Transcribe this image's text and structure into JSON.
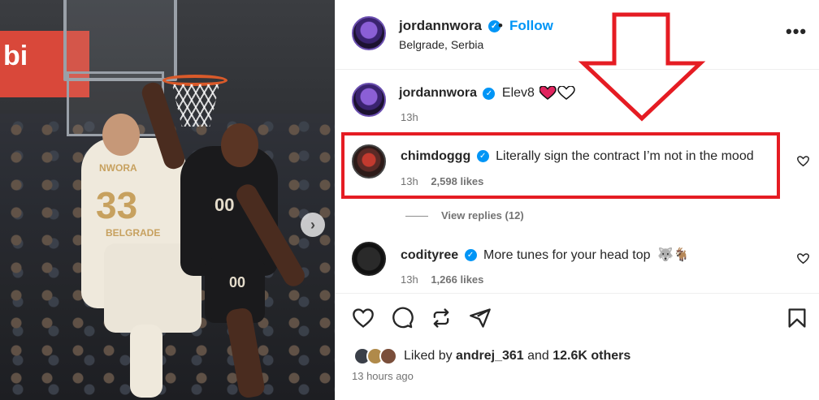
{
  "post": {
    "author": "jordannwora",
    "follow_label": "Follow",
    "separator": "•",
    "location": "Belgrade, Serbia",
    "more_label": "•••",
    "photo_banner_text": "bi",
    "jersey_white_name": "NWORA",
    "jersey_white_number": "33",
    "jersey_white_city": "BELGRADE",
    "jersey_black_number": "00",
    "shorts_black_number": "00",
    "next_glyph": "›"
  },
  "caption": {
    "user": "jordannwora",
    "text": "Elev8",
    "time": "13h"
  },
  "comments": [
    {
      "user": "chimdoggg",
      "text": "Literally sign the contract I’m not in the mood",
      "time": "13h",
      "likes": "2,598 likes"
    },
    {
      "user": "codityree",
      "text": "More tunes for your head top",
      "time": "13h",
      "likes": "1,266 likes"
    }
  ],
  "view_replies": "View replies (12)",
  "likes_summary": {
    "prefix": "Liked by ",
    "user": "andrej_361",
    "middle": " and ",
    "others": "12.6K others"
  },
  "posted_ago": "13 hours ago",
  "colors": {
    "accent": "#0095f6",
    "annotation": "#e51c23",
    "heart_red": "#ed4956"
  },
  "icons": [
    "heart-icon",
    "comment-icon",
    "share-icon",
    "send-icon",
    "bookmark-icon",
    "verified-icon",
    "more-icon"
  ]
}
